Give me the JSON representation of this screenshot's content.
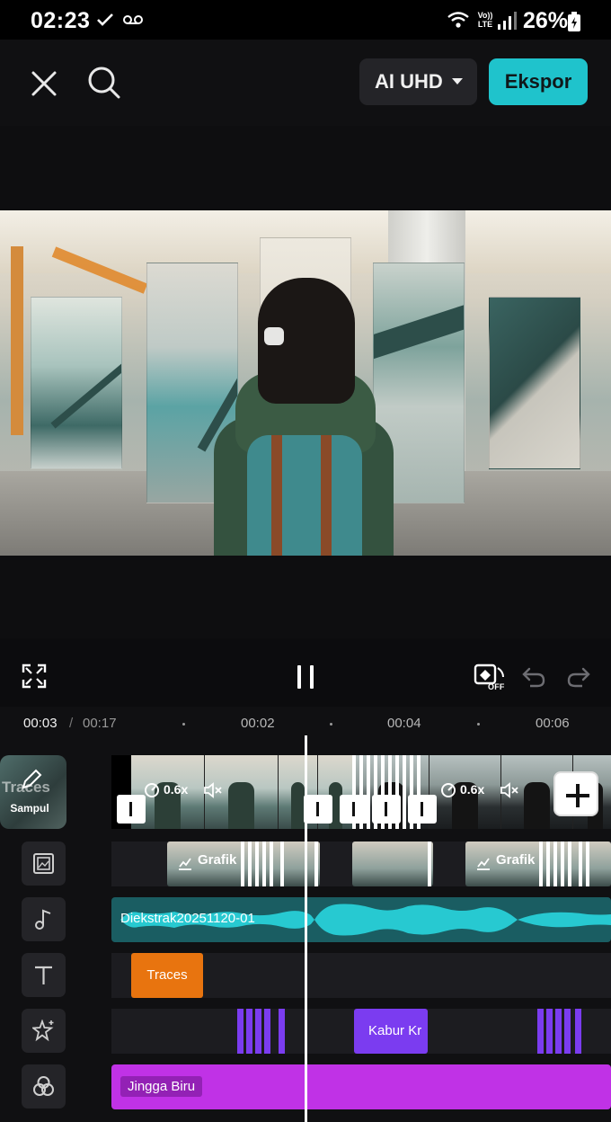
{
  "status_bar": {
    "time": "02:23",
    "network_label": "Vo)) LTE",
    "battery": "26%",
    "icons": [
      "check-icon",
      "voicemail-icon",
      "wifi-icon",
      "signal-icon",
      "battery-charging-icon"
    ]
  },
  "top_bar": {
    "quality_label": "AI UHD",
    "export_label": "Ekspor",
    "icons": [
      "close-icon",
      "search-icon",
      "dropdown-caret-icon"
    ]
  },
  "controls": {
    "keyframe_state": "OFF",
    "icons": [
      "fullscreen-icon",
      "pause-icon",
      "keyframe-toggle-icon",
      "undo-icon",
      "redo-icon"
    ]
  },
  "ruler": {
    "current_time": "00:03",
    "separator": "/",
    "total_time": "00:17",
    "ticks": [
      "00:02",
      "00:04",
      "00:06"
    ]
  },
  "timeline": {
    "cover": {
      "title": "Traces",
      "label": "Sampul"
    },
    "main_track": {
      "speeds": [
        "0.6x",
        "0.6x"
      ]
    },
    "overlay_clips": [
      "Grafik",
      "Grafik"
    ],
    "audio_clip": "Diekstrak20251120-01",
    "text_clip": "Traces",
    "effect_clip": "Kabur Kr",
    "filter_clip": "Jingga Biru",
    "side_icons": [
      "overlay-icon",
      "music-note-icon",
      "text-icon",
      "effects-star-icon",
      "filter-icon"
    ]
  },
  "colors": {
    "accent": "#1fc3cc",
    "audio": "#1a5d62",
    "text_clip": "#e8740f",
    "effect": "#7b3cf0",
    "filter": "#c032e6"
  }
}
